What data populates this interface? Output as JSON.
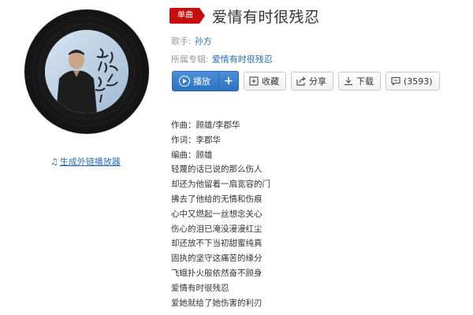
{
  "song": {
    "badge": "单曲",
    "title": "爱情有时很残忍"
  },
  "meta": {
    "artist_label": "歌手:",
    "artist": "孙方",
    "album_label": "所属专辑:",
    "album": "爱情有时很残忍"
  },
  "actions": {
    "play": "播放",
    "add": "+",
    "collect": "收藏",
    "share": "分享",
    "download": "下载",
    "comment": "(3593)"
  },
  "player_link": "生成外链播放器",
  "cover": {
    "overlay_text": "爱情有时很残忍"
  },
  "lyrics": [
    "作曲：顾雄/李郡华",
    "作词：李郡华",
    "编曲：顾雄",
    "轻蔑的话已说的那么伤人",
    "却还为他留着一扇宽容的门",
    "拂去了他给的无情和伤痕",
    "心中又燃起一丝想念关心",
    "伤心的泪已淹没漫漫红尘",
    "却还放不下当初甜蜜纯真",
    "固执的坚守这痛苦的缘分",
    "飞蛾扑火般依然奋不顾身",
    "爱情有时很残忍",
    "爱她就给了她伤害的利刃"
  ],
  "colors": {
    "badge": "#c70c0c",
    "link": "#2a6fb8",
    "play_button": "#2d72c1"
  }
}
